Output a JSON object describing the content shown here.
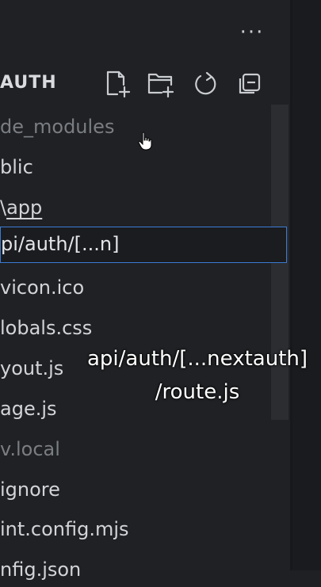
{
  "header": {
    "more_label": "···",
    "section_title": "AUTH"
  },
  "toolbar": {
    "new_file_icon": "new-file-icon",
    "new_folder_icon": "new-folder-icon",
    "refresh_icon": "refresh-icon",
    "collapse_icon": "collapse-all-icon"
  },
  "tree": {
    "items": [
      {
        "label": "de_modules",
        "dim": true
      },
      {
        "label": "blic",
        "dim": false
      },
      {
        "prefix": "\\",
        "label": "app",
        "dim": false
      },
      {
        "label": "vicon.ico",
        "dim": false
      },
      {
        "label": "lobals.css",
        "dim": false
      },
      {
        "label": "yout.js",
        "dim": false
      },
      {
        "label": "age.js",
        "dim": false
      },
      {
        "label": "v.local",
        "dim": true
      },
      {
        "label": "ignore",
        "dim": false
      },
      {
        "label": "int.config.mjs",
        "dim": false
      },
      {
        "label": "nfig.json",
        "dim": false
      }
    ]
  },
  "rename": {
    "value": "pi/auth/[...n]"
  },
  "caption": {
    "line1": "api/auth/[...nextauth]",
    "line2": "/route.js"
  },
  "colors": {
    "accent": "#3b7bd4",
    "background": "#1f2124"
  }
}
